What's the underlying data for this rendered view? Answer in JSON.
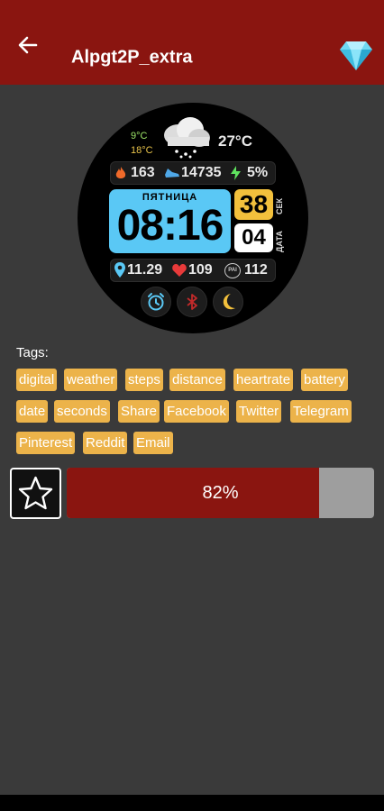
{
  "header": {
    "title": "Alpgt2P_extra",
    "back_icon": "arrow-left-icon",
    "premium_icon": "diamond-icon"
  },
  "watchface": {
    "temp_min": "9°C",
    "temp_max": "18°C",
    "temp_current": "27°C",
    "weather_icon": "cloud-snow-icon",
    "calories": "163",
    "steps": "14735",
    "battery": "5%",
    "day_of_week": "ПЯТНИЦА",
    "time": "08:16",
    "seconds": "38",
    "seconds_label": "СЕК",
    "date": "04",
    "date_label": "ДАТА",
    "distance": "11.29",
    "heart_rate": "109",
    "pai_label": "PAI",
    "pai": "112"
  },
  "tags": {
    "label": "Tags:",
    "items": [
      "digital",
      "weather",
      "steps",
      "distance",
      "heartrate",
      "battery",
      "date",
      "seconds",
      "Share",
      "Facebook",
      "Twitter",
      "Telegram",
      "Pinterest",
      "Reddit",
      "Email"
    ]
  },
  "rating": {
    "favorite_icon": "star-outline-icon"
  },
  "progress": {
    "text": "82%",
    "value": 0.82
  },
  "colors": {
    "appbar": "#8a1510",
    "background": "#3a3a3a",
    "tag": "#ecb34a",
    "progress_fill": "#8a1510",
    "progress_track": "#9e9e9e",
    "time_panel": "#5ac8f5",
    "seconds_panel": "#f2c03c"
  }
}
